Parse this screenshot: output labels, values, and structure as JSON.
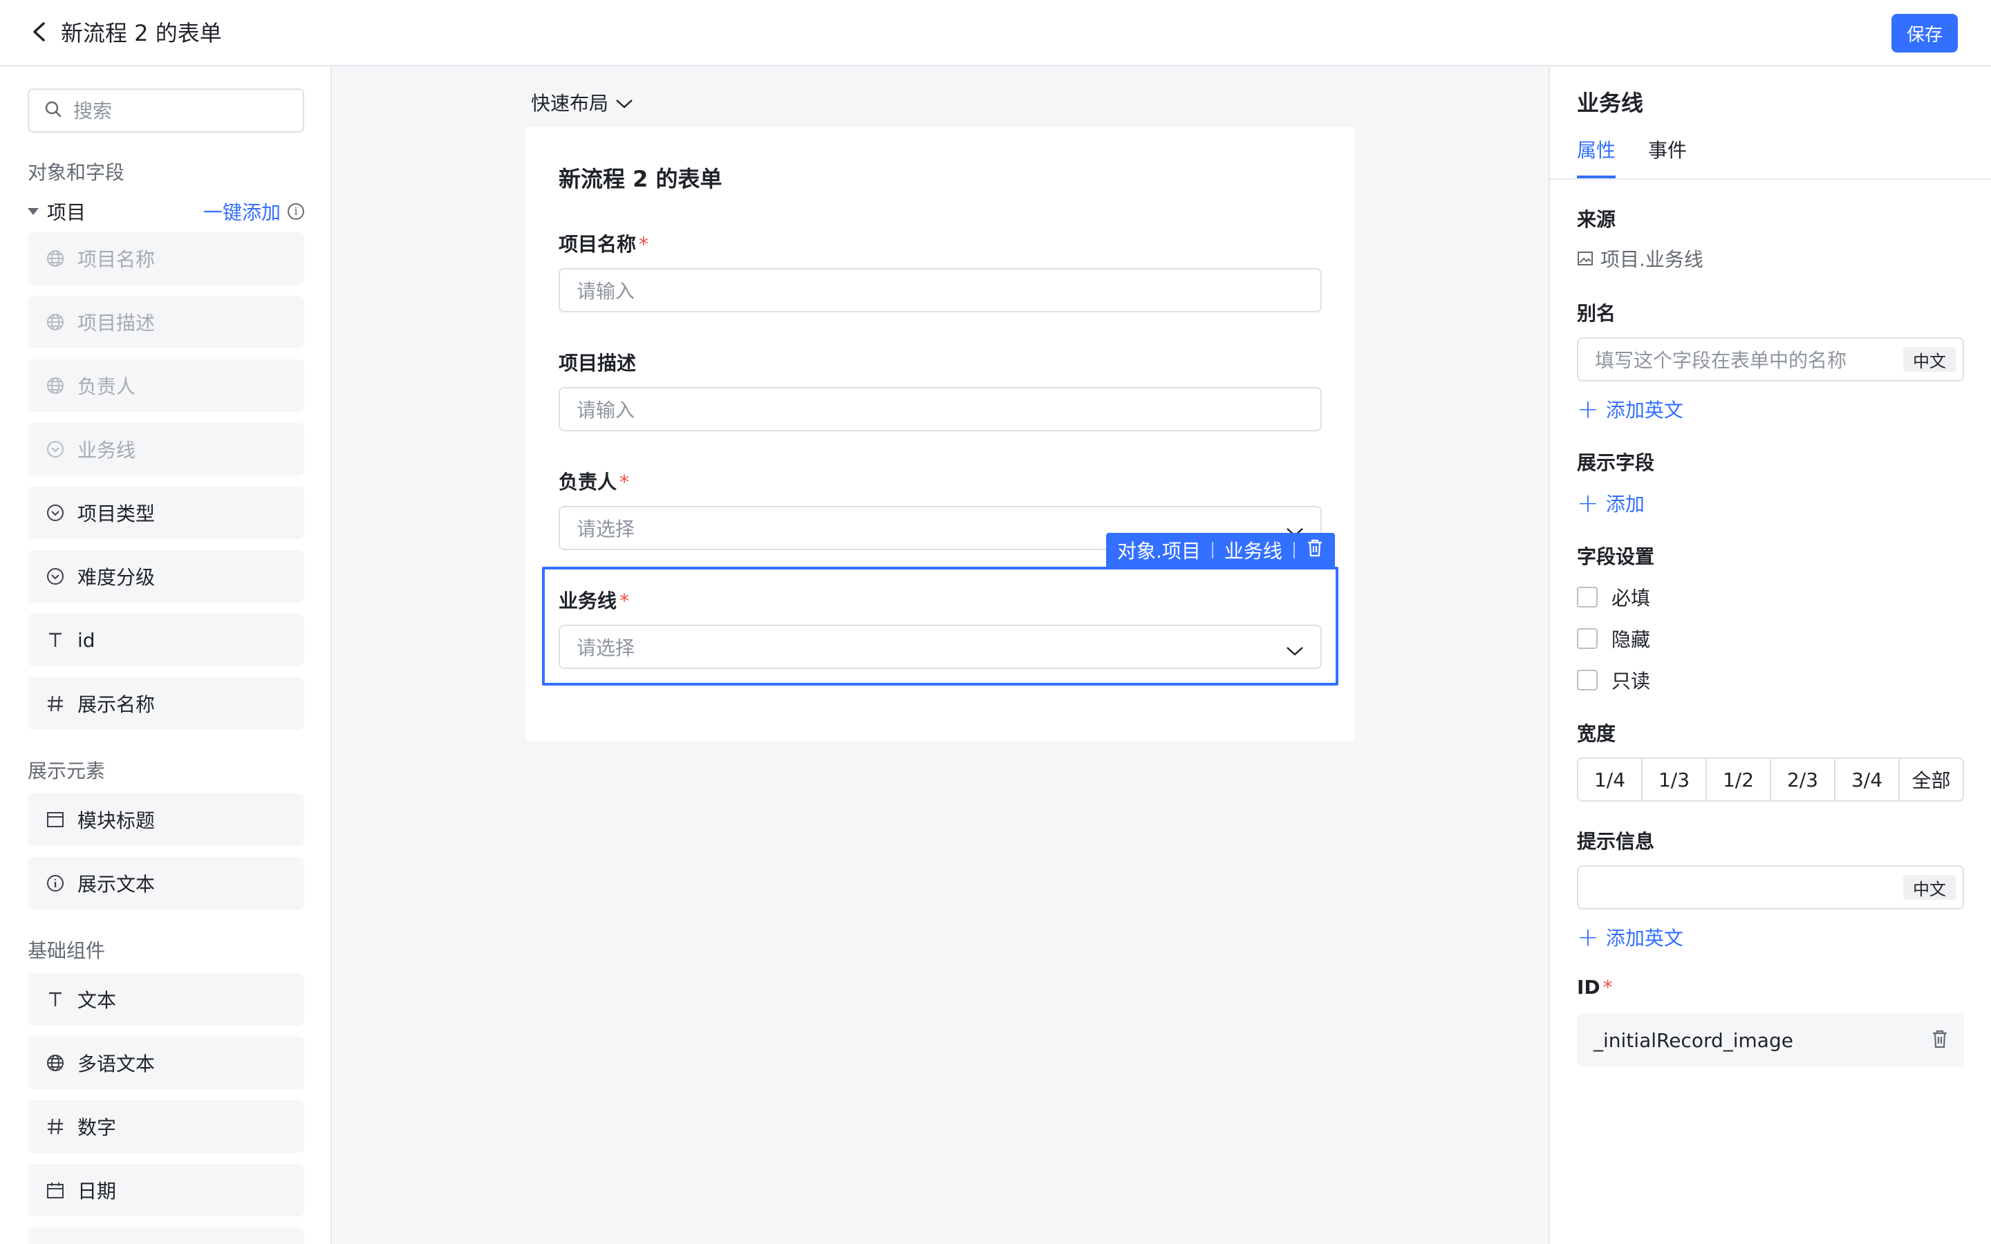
{
  "header": {
    "title": "新流程 2 的表单",
    "save_label": "保存"
  },
  "sidebar": {
    "search_placeholder": "搜索",
    "section_objects": "对象和字段",
    "group_name": "项目",
    "one_click_add": "一键添加",
    "info_icon": "i",
    "object_fields": [
      {
        "label": "项目名称",
        "icon": "globe-icon",
        "disabled": true
      },
      {
        "label": "项目描述",
        "icon": "globe-icon",
        "disabled": true
      },
      {
        "label": "负责人",
        "icon": "globe-icon",
        "disabled": true
      },
      {
        "label": "业务线",
        "icon": "dropdown-circle-icon",
        "disabled": true
      },
      {
        "label": "项目类型",
        "icon": "dropdown-circle-icon",
        "disabled": false
      },
      {
        "label": "难度分级",
        "icon": "dropdown-circle-icon",
        "disabled": false
      },
      {
        "label": "id",
        "icon": "text-icon",
        "disabled": false
      },
      {
        "label": "展示名称",
        "icon": "hash-icon",
        "disabled": false
      }
    ],
    "section_display": "展示元素",
    "display_items": [
      {
        "label": "模块标题",
        "icon": "module-title-icon"
      },
      {
        "label": "展示文本",
        "icon": "info-icon"
      }
    ],
    "section_basic": "基础组件",
    "basic_items": [
      {
        "label": "文本",
        "icon": "text-icon"
      },
      {
        "label": "多语文本",
        "icon": "globe-icon"
      },
      {
        "label": "数字",
        "icon": "hash-icon"
      },
      {
        "label": "日期",
        "icon": "calendar-icon"
      }
    ]
  },
  "canvas": {
    "quick_layout": "快速布局",
    "form_title": "新流程 2 的表单",
    "fields": [
      {
        "label": "项目名称",
        "required": true,
        "placeholder": "请输入",
        "type": "input"
      },
      {
        "label": "项目描述",
        "required": false,
        "placeholder": "请输入",
        "type": "input"
      },
      {
        "label": "负责人",
        "required": true,
        "placeholder": "请选择",
        "type": "select"
      },
      {
        "label": "业务线",
        "required": true,
        "placeholder": "请选择",
        "type": "select"
      }
    ],
    "required_mark": "*",
    "selected_tag": {
      "object": "对象.项目",
      "field": "业务线"
    }
  },
  "panel": {
    "title": "业务线",
    "tabs": [
      "属性",
      "事件"
    ],
    "active_tab": 0,
    "source_label": "来源",
    "source_value": "项目.业务线",
    "alias_label": "别名",
    "alias_placeholder": "填写这个字段在表单中的名称",
    "lang_badge": "中文",
    "add_english": "添加英文",
    "display_field_label": "展示字段",
    "add_label": "添加",
    "field_settings_label": "字段设置",
    "settings": [
      "必填",
      "隐藏",
      "只读"
    ],
    "width_label": "宽度",
    "width_options": [
      "1/4",
      "1/3",
      "1/2",
      "2/3",
      "3/4",
      "全部"
    ],
    "hint_label": "提示信息",
    "hint_value": "",
    "id_label": "ID",
    "id_value": "_initialRecord_image"
  },
  "colors": {
    "accent": "#3370ff",
    "required": "#f54a45",
    "canvas_bg": "#f5f6f7"
  }
}
